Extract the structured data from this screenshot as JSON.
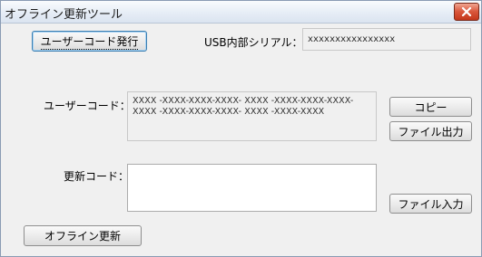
{
  "window": {
    "title": "オフライン更新ツール",
    "close_glyph": "✕"
  },
  "buttons": {
    "issue_user_code": "ユーザーコード発行",
    "copy": "コピー",
    "file_output": "ファイル出力",
    "file_input": "ファイル入力",
    "offline_update": "オフライン更新"
  },
  "usb_serial": {
    "label": "USB内部シリアル：",
    "value": "xxxxxxxxxxxxxxxx"
  },
  "user_code": {
    "label": "ユーザーコード：",
    "value": "XXXX -XXXX-XXXX-XXXX- XXXX -XXXX-XXXX-XXXX-\nXXXX -XXXX-XXXX-XXXX- XXXX -XXXX-XXXX"
  },
  "update_code": {
    "label": "更新コード：",
    "value": ""
  },
  "colors": {
    "title_bar_top": "#f9fbfd",
    "close_button": "#d9553a",
    "window_bg": "#f0f0f0"
  }
}
